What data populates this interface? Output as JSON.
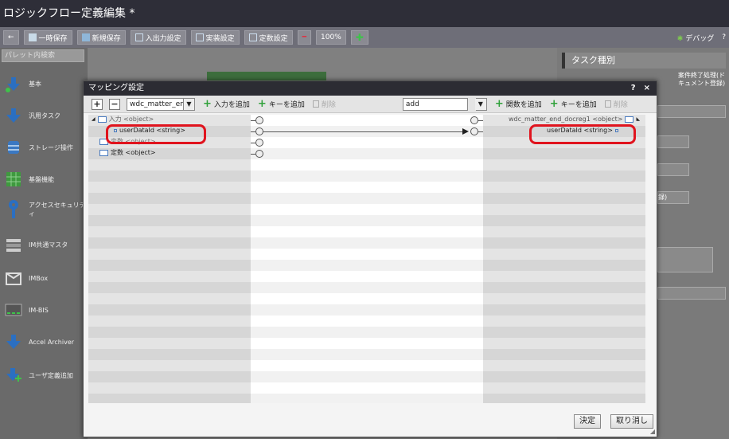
{
  "window": {
    "title": "ロジックフロー定義編集",
    "modified_marker": " *"
  },
  "toolbar": {
    "buttons": [
      "一時保存",
      "新規保存",
      "入出力設定",
      "実装設定",
      "定数設定"
    ],
    "zoom": "100%",
    "right": [
      "デバッグ",
      "?"
    ]
  },
  "sidebar": {
    "search_placeholder": "パレット内検索",
    "items": [
      "基本",
      "汎用タスク",
      "ストレージ操作",
      "基盤機能",
      "アクセスセキュリティ",
      "IM共通マスタ",
      "IMBox",
      "IM-BIS",
      "Accel Archiver",
      "ユーザ定義追加"
    ]
  },
  "right_panel": {
    "title": "タスク種別",
    "end_task_label": "案件終了処理(ドキュメント登録)",
    "partial_text": "録)"
  },
  "dialog": {
    "title": "マッピング設定",
    "help": "?",
    "close": "×",
    "left_select": "wdc_matter_end_",
    "add_input": "入力を追加",
    "add_key_left": "キーを追加",
    "delete_left": "削除",
    "function_select": "add",
    "add_function": "関数を追加",
    "add_key_right": "キーを追加",
    "delete_right": "削除",
    "left_tree": [
      {
        "label": "入力 <object>"
      },
      {
        "label": "userDataId <string>"
      },
      {
        "label": "変数 <object>"
      },
      {
        "label": "定数 <object>"
      }
    ],
    "right_tree": [
      {
        "label": "wdc_matter_end_docreg1 <object>"
      },
      {
        "label": "userDataId <string>"
      }
    ],
    "ok": "決定",
    "cancel": "取り消し"
  }
}
